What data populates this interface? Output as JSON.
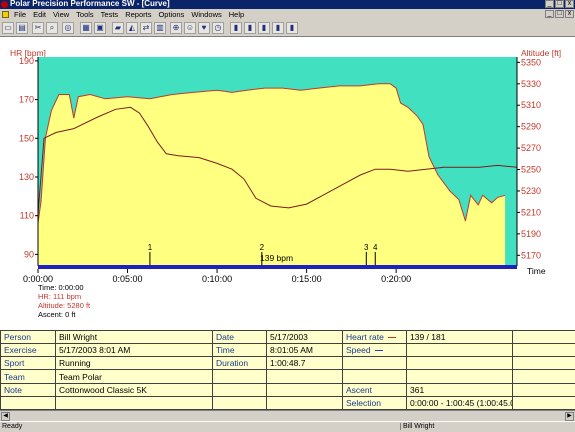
{
  "window": {
    "title": "Polar Precision Performance SW - [Curve]",
    "minimize": "_",
    "maximize": "□",
    "close": "x"
  },
  "menu": [
    "File",
    "Edit",
    "View",
    "Tools",
    "Tests",
    "Reports",
    "Options",
    "Windows",
    "Help"
  ],
  "toolbar_icons": [
    "open-icon",
    "save-icon",
    "scissors-icon",
    "search-icon",
    "globe-icon",
    "grid-icon",
    "calendar-icon",
    "folder-icon",
    "chart-icon",
    "compare-icon",
    "table-icon",
    "zoom-icon",
    "user-icon",
    "heart-icon",
    "stopwatch-icon",
    "bar-chart-icon",
    "bar-chart-2-icon",
    "bar-chart-3-icon",
    "bar-chart-4-icon",
    "bar-chart-5-icon"
  ],
  "chart": {
    "left_axis_title": "HR [bpm]",
    "right_axis_title": "Altitude [ft]",
    "x_axis_title": "Time",
    "hr_marker_text": "139 bpm",
    "laps": [
      "1",
      "2",
      "3",
      "4"
    ]
  },
  "cursor": {
    "time": "Time: 0:00:00",
    "hr": "HR: 111 bpm",
    "altitude": "Altitude: 5280 ft",
    "ascent": "Ascent: 0 ft"
  },
  "chart_data": {
    "type": "line",
    "colors": {
      "hr": "#c0392b",
      "altitude_fill": "#ffff80",
      "altitude_line": "#c0392b",
      "upper_zone": "#40e0c0",
      "timeline": "#2020c0"
    },
    "xlabel": "Time",
    "xlim_seconds": [
      0,
      1605
    ],
    "x_ticks": [
      "0:00:00",
      "0:05:00",
      "0:10:00",
      "0:15:00",
      "0:20:00"
    ],
    "y_left": {
      "label": "HR [bpm]",
      "ylim": [
        84,
        192
      ],
      "ticks": [
        90,
        110,
        130,
        150,
        170,
        190
      ]
    },
    "y_right": {
      "label": "Altitude [ft]",
      "ylim": [
        5160,
        5355
      ],
      "ticks": [
        5170,
        5190,
        5210,
        5230,
        5250,
        5270,
        5290,
        5310,
        5330,
        5350
      ]
    },
    "lap_times": [
      375,
      750,
      1100,
      1130
    ],
    "series": [
      {
        "name": "Heart rate",
        "axis": "left",
        "points": [
          [
            0,
            111
          ],
          [
            20,
            150
          ],
          [
            60,
            153
          ],
          [
            120,
            155
          ],
          [
            200,
            161
          ],
          [
            260,
            165
          ],
          [
            310,
            166
          ],
          [
            340,
            163
          ],
          [
            370,
            156
          ],
          [
            400,
            148
          ],
          [
            430,
            142
          ],
          [
            470,
            141
          ],
          [
            540,
            140
          ],
          [
            600,
            137
          ],
          [
            650,
            134
          ],
          [
            690,
            129
          ],
          [
            730,
            119
          ],
          [
            780,
            115
          ],
          [
            840,
            114
          ],
          [
            900,
            116
          ],
          [
            960,
            121
          ],
          [
            1020,
            126
          ],
          [
            1080,
            131
          ],
          [
            1130,
            134
          ],
          [
            1180,
            134
          ],
          [
            1240,
            133
          ],
          [
            1300,
            134
          ],
          [
            1360,
            135
          ],
          [
            1420,
            135
          ],
          [
            1480,
            135
          ],
          [
            1540,
            136
          ],
          [
            1605,
            135
          ]
        ]
      },
      {
        "name": "Altitude",
        "axis": "right",
        "points": [
          [
            0,
            5200
          ],
          [
            10,
            5220
          ],
          [
            25,
            5280
          ],
          [
            45,
            5305
          ],
          [
            70,
            5320
          ],
          [
            105,
            5320
          ],
          [
            120,
            5298
          ],
          [
            135,
            5318
          ],
          [
            175,
            5320
          ],
          [
            225,
            5316
          ],
          [
            300,
            5318
          ],
          [
            375,
            5316
          ],
          [
            450,
            5320
          ],
          [
            520,
            5322
          ],
          [
            600,
            5324
          ],
          [
            650,
            5322
          ],
          [
            700,
            5324
          ],
          [
            760,
            5326
          ],
          [
            820,
            5326
          ],
          [
            880,
            5324
          ],
          [
            940,
            5326
          ],
          [
            1010,
            5328
          ],
          [
            1080,
            5328
          ],
          [
            1140,
            5330
          ],
          [
            1180,
            5330
          ],
          [
            1200,
            5326
          ],
          [
            1215,
            5312
          ],
          [
            1240,
            5308
          ],
          [
            1270,
            5300
          ],
          [
            1290,
            5292
          ],
          [
            1310,
            5262
          ],
          [
            1340,
            5245
          ],
          [
            1380,
            5230
          ],
          [
            1410,
            5222
          ],
          [
            1432,
            5202
          ],
          [
            1450,
            5226
          ],
          [
            1475,
            5217
          ],
          [
            1490,
            5226
          ],
          [
            1520,
            5219
          ],
          [
            1540,
            5224
          ],
          [
            1565,
            5226
          ]
        ]
      }
    ]
  },
  "info": {
    "rows": [
      [
        "Person",
        "Bill Wright",
        "Date",
        "5/17/2003",
        "Heart rate",
        "139 / 181",
        "",
        ""
      ],
      [
        "Exercise",
        "5/17/2003 8:01 AM",
        "Time",
        "8:01:05 AM",
        "Speed",
        "",
        "",
        ""
      ],
      [
        "Sport",
        "Running",
        "Duration",
        "1:00:48.7",
        "",
        "",
        "",
        ""
      ],
      [
        "Team",
        "Team Polar",
        "",
        "",
        "",
        "",
        "",
        ""
      ],
      [
        "Note",
        "Cottonwood Classic 5K",
        "",
        "",
        "Ascent",
        "361",
        "",
        ""
      ],
      [
        "",
        "",
        "",
        "",
        "Selection",
        "0:00:00 - 1:00:45 (1:00:45.0)",
        "",
        ""
      ]
    ]
  },
  "status": {
    "left": "Ready",
    "right": "Bill Wright"
  }
}
